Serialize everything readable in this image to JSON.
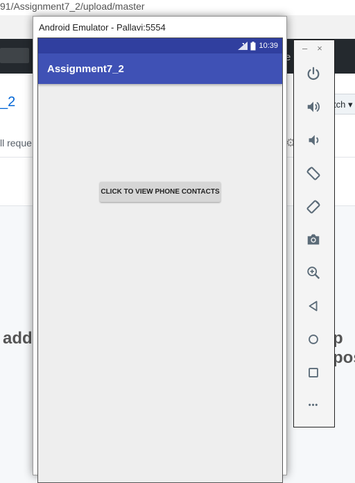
{
  "browser": {
    "url_fragment": "91/Assignment7_2/upload/master",
    "repo_link": "_2",
    "requ_fragment": "ll reque",
    "branch_fragment": "tch",
    "header_fragment": "e",
    "bottom_left_fragment": "add",
    "bottom_right_fragment": "p  pos"
  },
  "emulator": {
    "window_title": "Android Emulator - Pallavi:5554",
    "status_time": "10:39",
    "app_title": "Assignment7_2",
    "button_label": "CLICK TO VIEW PHONE CONTACTS",
    "toolbar": {
      "minimize": "–",
      "close": "×",
      "more": "•••"
    }
  },
  "colors": {
    "primary": "#3f51b5",
    "primary_dark": "#303f9f",
    "screen_bg": "#eeeeee",
    "toolbar_icon": "#5b6b78"
  }
}
